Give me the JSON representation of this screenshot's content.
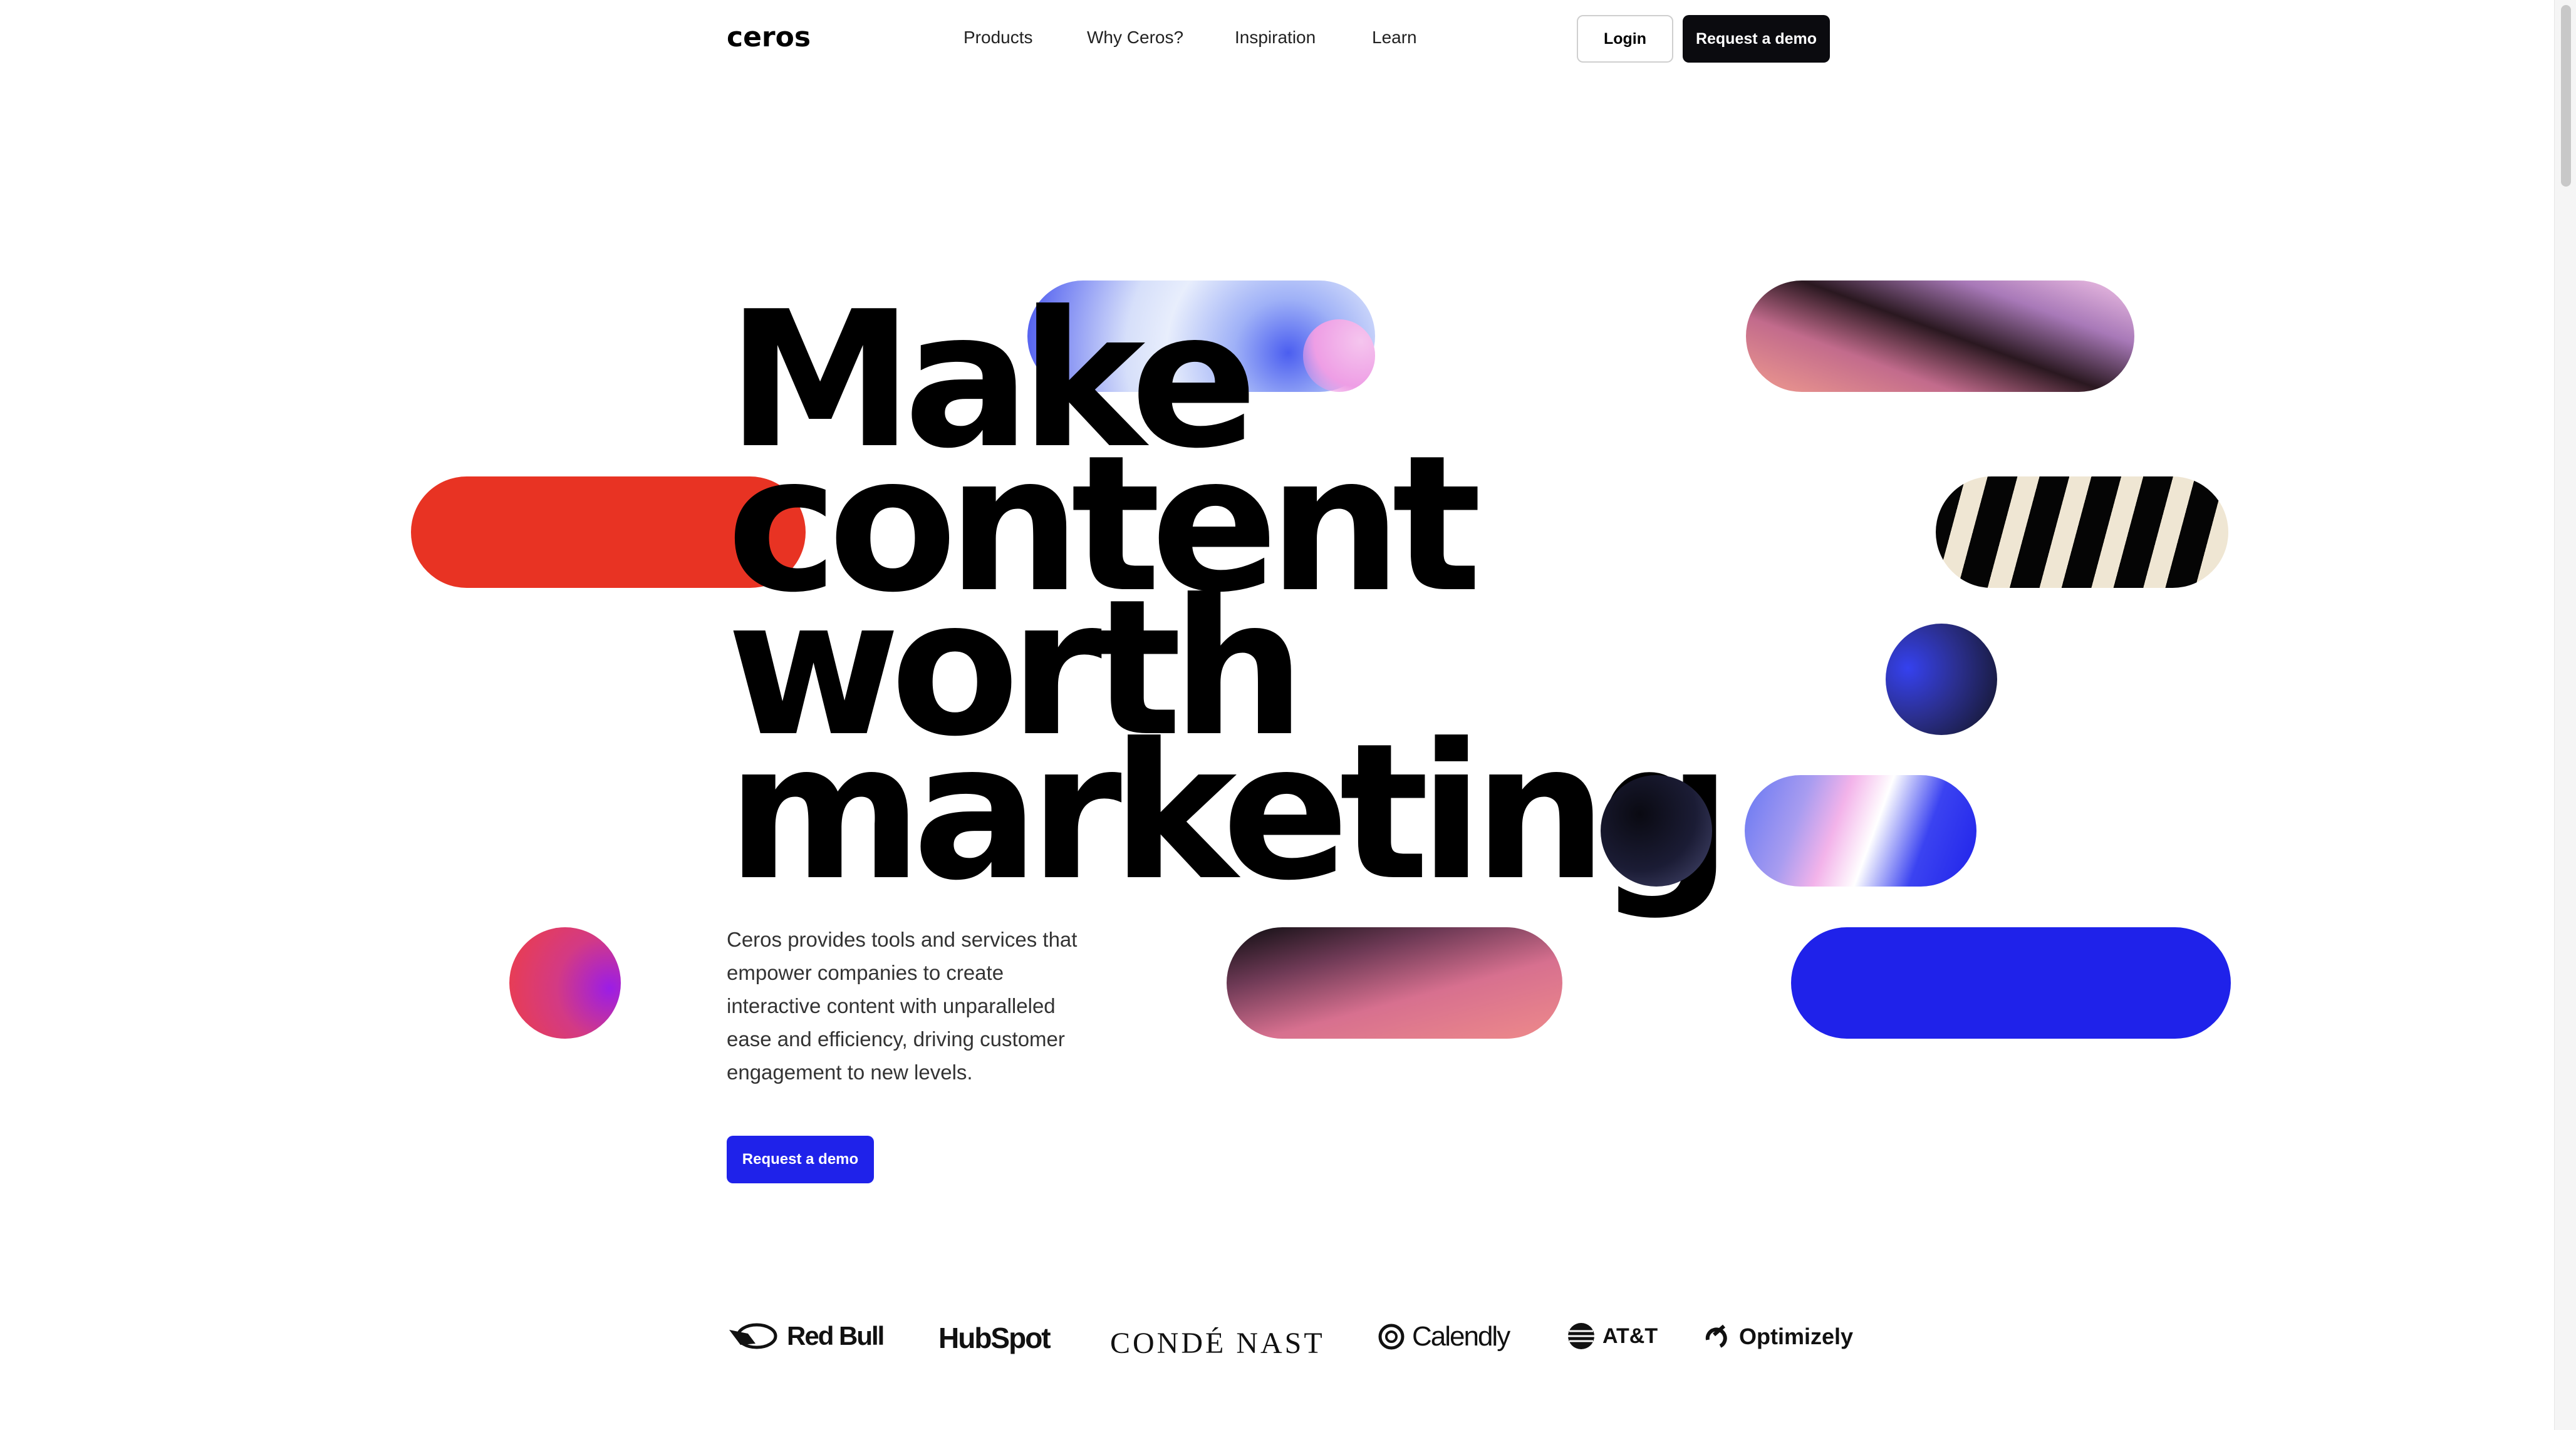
{
  "nav": {
    "logo": "ceros",
    "links": [
      "Products",
      "Why Ceros?",
      "Inspiration",
      "Learn"
    ],
    "login_label": "Login",
    "demo_label": "Request a demo"
  },
  "hero": {
    "lines": [
      "Make",
      "content",
      "worth",
      "marketing"
    ],
    "description": "Ceros provides tools and services that empower companies to create interactive content with unparalleled ease and efficiency, driving customer engagement to new levels.",
    "cta_label": "Request a demo"
  },
  "logos": [
    "Red Bull",
    "HubSpot",
    "CONDÉ NAST",
    "Calendly",
    "AT&T",
    "Optimizely"
  ],
  "colors": {
    "primary_blue": "#1f22ea",
    "red": "#e83323",
    "black_button": "#0b0b0f"
  }
}
